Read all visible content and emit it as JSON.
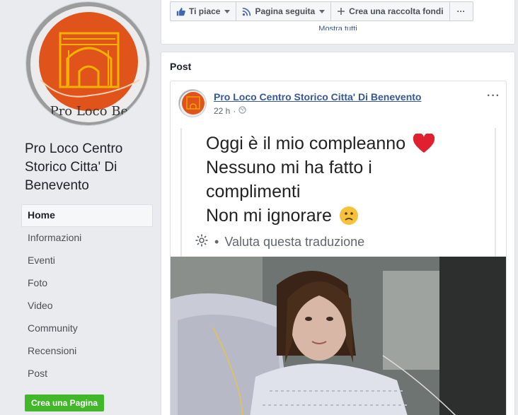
{
  "page": {
    "name": "Pro Loco Centro Storico Citta' Di Benevento",
    "profile_logo_text": "Pro Loco Benevento"
  },
  "nav": {
    "items": [
      {
        "label": "Home",
        "active": true
      },
      {
        "label": "Informazioni"
      },
      {
        "label": "Eventi"
      },
      {
        "label": "Foto"
      },
      {
        "label": "Video"
      },
      {
        "label": "Community"
      },
      {
        "label": "Recensioni"
      },
      {
        "label": "Post"
      }
    ],
    "create_page_label": "Crea una Pagina"
  },
  "actions": {
    "like_label": "Ti piace",
    "follow_label": "Pagina seguita",
    "fundraiser_label": "Crea una raccolta fondi",
    "more_label": "···",
    "show_all_label": "Mostra tutti"
  },
  "post_section": {
    "heading": "Post",
    "author": "Pro Loco Centro Storico Citta' Di Benevento",
    "time": "22 h",
    "more": "···",
    "image_text": {
      "line1": "Oggi è il mio compleanno",
      "line2": "Nessuno mi ha fatto i",
      "line3": "complimenti",
      "line4": "Non mi ignorare",
      "translate_bullet": "•",
      "translate_label": "Valuta questa traduzione"
    }
  },
  "colors": {
    "link": "#365899",
    "green_button": "#42b72a",
    "page_bg": "#e9ebee"
  }
}
